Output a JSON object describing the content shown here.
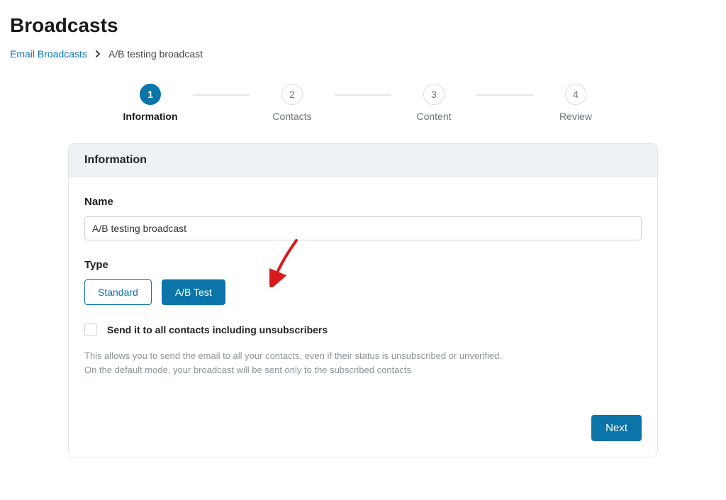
{
  "page": {
    "title": "Broadcasts"
  },
  "breadcrumbs": {
    "link": "Email Broadcasts",
    "current": "A/B testing broadcast"
  },
  "stepper": {
    "steps": [
      {
        "num": "1",
        "label": "Information",
        "active": true
      },
      {
        "num": "2",
        "label": "Contacts",
        "active": false
      },
      {
        "num": "3",
        "label": "Content",
        "active": false
      },
      {
        "num": "4",
        "label": "Review",
        "active": false
      }
    ]
  },
  "panel": {
    "header": "Information",
    "name_label": "Name",
    "name_value": "A/B testing broadcast",
    "type_label": "Type",
    "type_options": {
      "standard": "Standard",
      "abtest": "A/B Test",
      "selected": "abtest"
    },
    "checkbox_label": "Send it to all contacts including unsubscribers",
    "help_1": "This allows you to send the email to all your contacts, even if their status is unsubscribed or unverified.",
    "help_2": "On the default mode, your broadcast will be sent only to the subscribed contacts",
    "next_label": "Next"
  },
  "colors": {
    "accent": "#0b74a9",
    "link": "#0a78b8",
    "annotation": "#d71a1a"
  }
}
